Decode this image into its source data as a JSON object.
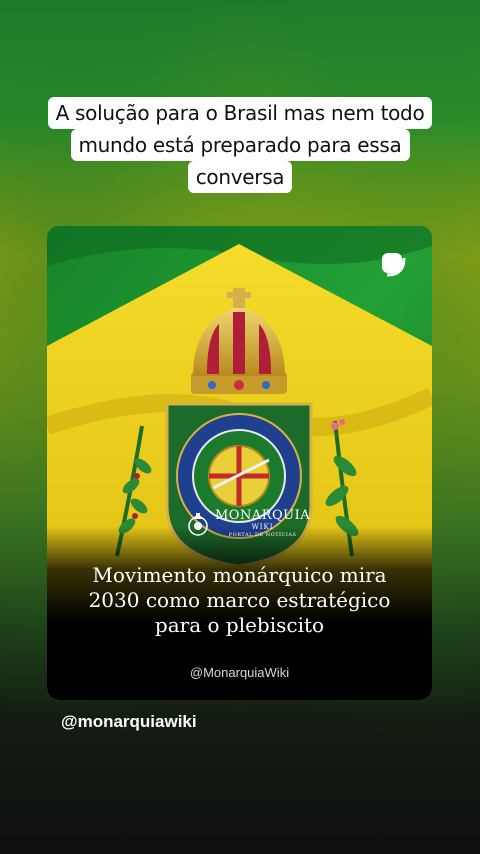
{
  "caption": {
    "lines": [
      "A solução para o Brasil mas nem todo",
      "mundo está preparado para essa",
      "conversa"
    ]
  },
  "post": {
    "headline_lines": [
      "Movimento monárquico mira",
      "2030 como marco estratégico",
      "para o plebiscito"
    ],
    "handle": "@MonarquiaWiki",
    "brand": {
      "name": "MONARQUIA",
      "wiki": "WIKI",
      "tagline": "PORTAL DE NOTÍCIAS"
    }
  },
  "author": {
    "username": "@monarquiawiki"
  },
  "colors": {
    "flag_green": "#1e8a2c",
    "flag_yellow": "#f2d21a",
    "crown_gold": "#d8b23a",
    "shield_green": "#1d6b2a",
    "shield_blue": "#1f3f8f"
  },
  "icons": {
    "repost": "repost-icon"
  }
}
